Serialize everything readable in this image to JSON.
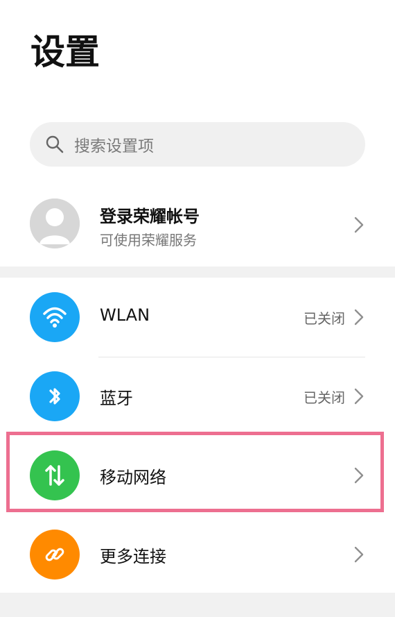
{
  "header": {
    "title": "设置"
  },
  "search": {
    "placeholder": "搜索设置项"
  },
  "account": {
    "title": "登录荣耀帐号",
    "subtitle": "可使用荣耀服务"
  },
  "settings": [
    {
      "label": "WLAN",
      "value": "已关闭",
      "icon": "wifi-icon",
      "color": "#1aa7f5"
    },
    {
      "label": "蓝牙",
      "value": "已关闭",
      "icon": "bluetooth-icon",
      "color": "#1aa7f5"
    },
    {
      "label": "移动网络",
      "value": "",
      "icon": "mobile-network-icon",
      "color": "#34c34f"
    },
    {
      "label": "更多连接",
      "value": "",
      "icon": "link-icon",
      "color": "#ff8a00"
    }
  ],
  "highlight": {
    "color": "#ed6f90"
  }
}
